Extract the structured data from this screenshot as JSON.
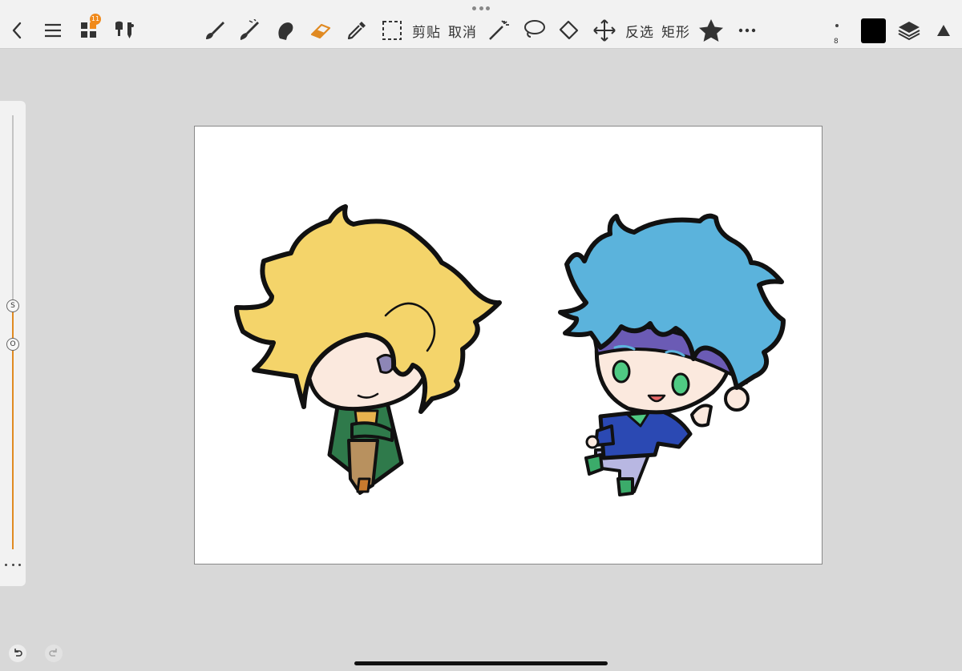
{
  "toolbar": {
    "badge_count": "11",
    "cut_label": "剪贴",
    "cancel_label": "取消",
    "invert_label": "反选",
    "rect_label": "矩形",
    "brush_size": "8",
    "current_color": "#000000",
    "accent_color": "#f08a1c",
    "icons": [
      "back-icon",
      "menu-icon",
      "gallery-icon",
      "brush-library-icon",
      "brush-icon",
      "paint-icon",
      "smudge-icon",
      "eraser-icon",
      "eyedropper-icon",
      "select-icon",
      "magic-wand-icon",
      "lasso-icon",
      "fill-icon",
      "move-icon",
      "star-icon",
      "more-icon",
      "layers-icon",
      "expand-icon"
    ]
  },
  "side_panel": {
    "size_knob_label": "S",
    "opacity_knob_label": "O",
    "accent_color": "#e08a22"
  },
  "canvas": {
    "background": "#ffffff",
    "characters": [
      "blonde-chibi-character",
      "blue-hair-chibi-character"
    ]
  }
}
